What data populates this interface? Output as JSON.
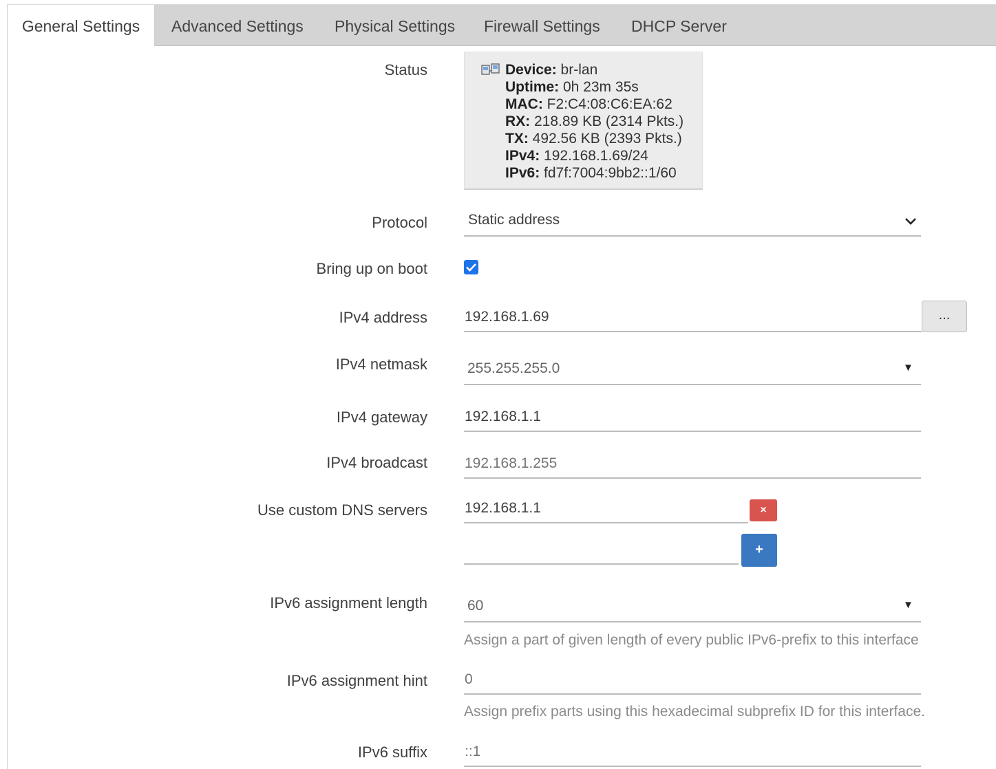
{
  "tabs": [
    {
      "label": "General Settings",
      "active": true
    },
    {
      "label": "Advanced Settings"
    },
    {
      "label": "Physical Settings"
    },
    {
      "label": "Firewall Settings"
    },
    {
      "label": "DHCP Server"
    }
  ],
  "status": {
    "label": "Status",
    "device_key": "Device:",
    "device_val": " br-lan",
    "uptime_key": "Uptime:",
    "uptime_val": " 0h 23m 35s",
    "mac_key": "MAC:",
    "mac_val": " F2:C4:08:C6:EA:62",
    "rx_key": "RX:",
    "rx_val": " 218.89 KB (2314 Pkts.)",
    "tx_key": "TX:",
    "tx_val": " 492.56 KB (2393 Pkts.)",
    "ipv4_key": "IPv4:",
    "ipv4_val": " 192.168.1.69/24",
    "ipv6_key": "IPv6:",
    "ipv6_val": " fd7f:7004:9bb2::1/60",
    "icon": "network-device-icon"
  },
  "protocol": {
    "label": "Protocol",
    "value": "Static address"
  },
  "boot": {
    "label": "Bring up on boot",
    "checked": true
  },
  "ipv4_address": {
    "label": "IPv4 address",
    "value": "192.168.1.69",
    "button": "..."
  },
  "ipv4_netmask": {
    "label": "IPv4 netmask",
    "value": "255.255.255.0"
  },
  "ipv4_gateway": {
    "label": "IPv4 gateway",
    "value": "192.168.1.1"
  },
  "ipv4_broadcast": {
    "label": "IPv4 broadcast",
    "placeholder": "192.168.1.255"
  },
  "dns": {
    "label": "Use custom DNS servers",
    "value": "192.168.1.1",
    "remove": "×",
    "add": "+"
  },
  "ipv6_length": {
    "label": "IPv6 assignment length",
    "value": "60",
    "hint": "Assign a part of given length of every public IPv6-prefix to this interface"
  },
  "ipv6_hint": {
    "label": "IPv6 assignment hint",
    "placeholder": "0",
    "hint": "Assign prefix parts using this hexadecimal subprefix ID for this interface."
  },
  "ipv6_suffix": {
    "label": "IPv6 suffix",
    "placeholder": "::1"
  },
  "colors": {
    "checkbox": "#1e73e8",
    "remove": "#d9534f",
    "add": "#3a78c2"
  }
}
